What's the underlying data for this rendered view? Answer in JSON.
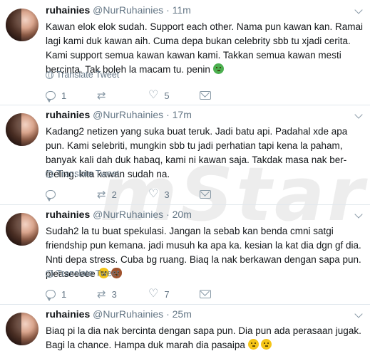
{
  "tweets": [
    {
      "name": "ruhainies",
      "handle": "@NurRuhainies",
      "time": "· 11m",
      "text": "Kawan elok elok sudah. Support each other. Nama pun kawan kan. Ramai lagi kami duk kawan aih. Cuma depa bukan celebrity sbb tu xjadi cerita. Kami support semua kawan kawan kami. Takkan semua kawan mesti bercinta. Tak boleh la macam tu. penin",
      "emoji": [
        "nauseated-face"
      ],
      "translate": "Translate Tweet",
      "reply_count": "1",
      "retweet_count": "",
      "like_count": "5"
    },
    {
      "name": "ruhainies",
      "handle": "@NurRuhainies",
      "time": "· 17m",
      "text": "Kadang2 netizen yang suka buat teruk. Jadi batu api. Padahal xde apa pun. Kami selebriti, mungkin sbb tu jadi perhatian tapi kena la paham, banyak kali dah duk habaq, kami ni kawan saja. Takdak masa nak ber-feeling. kita kawan sudah na.",
      "emoji": [],
      "translate": "Translate Tweet",
      "reply_count": "",
      "retweet_count": "2",
      "like_count": "3"
    },
    {
      "name": "ruhainies",
      "handle": "@NurRuhainies",
      "time": "· 20m",
      "text": "Sudah2 la tu buat spekulasi. Jangan la sebab kan benda cmni satgi friendship pun kemana. jadi musuh ka apa ka. kesian la kat dia dgn gf dia. Nnti depa stress. Cuba bg ruang. Biaq la nak berkawan dengan sapa pun. pleaseeeee",
      "emoji": [
        "grimacing-face",
        "see-no-evil-monkey"
      ],
      "translate": "Translate Tweet",
      "reply_count": "1",
      "retweet_count": "3",
      "like_count": "7"
    },
    {
      "name": "ruhainies",
      "handle": "@NurRuhainies",
      "time": "· 25m",
      "text": "Biaq pi la dia nak bercinta dengan sapa pun. Dia pun ada perasaan jugak. Bagi la chance. Hampa duk marah dia pasaipa",
      "emoji": [
        "face-with-raised-eyebrow",
        "face-with-rolling-eyes"
      ],
      "translate": "",
      "reply_count": "",
      "retweet_count": "",
      "like_count": ""
    }
  ],
  "watermark": "mStar",
  "colors": {
    "text": "#14171a",
    "muted": "#657786",
    "icon": "#8899a6",
    "divider": "#e1e8ed"
  }
}
